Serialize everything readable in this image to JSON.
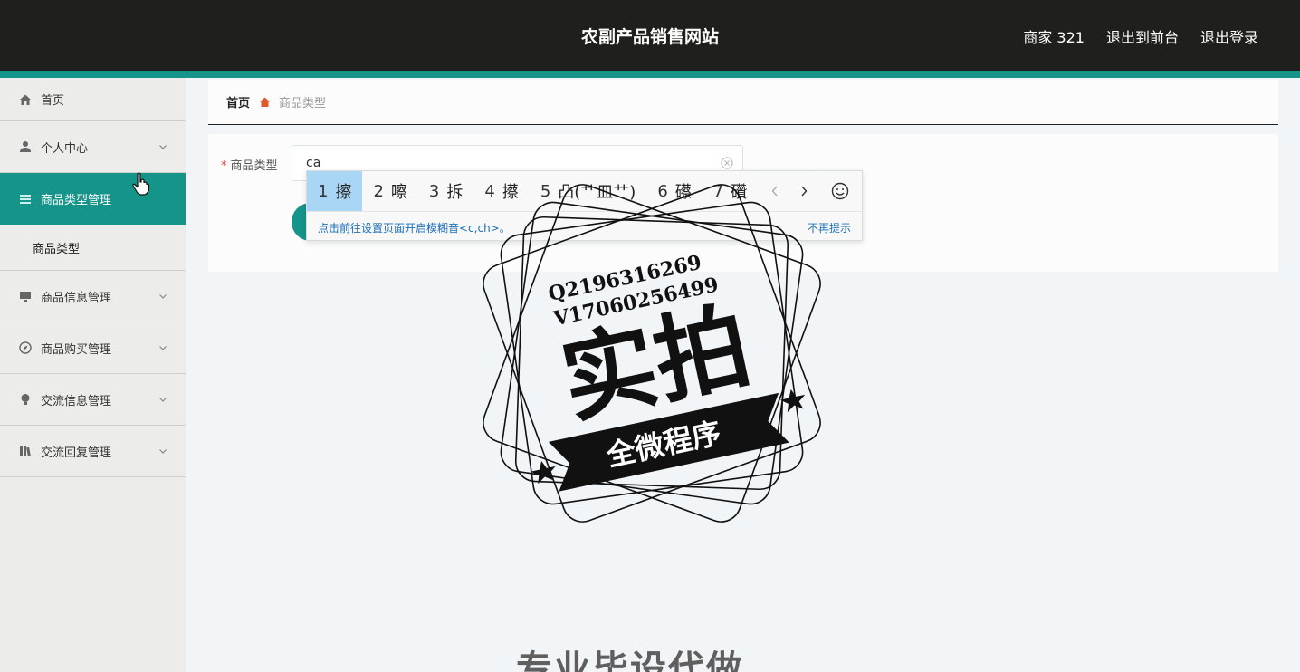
{
  "header": {
    "title": "农副产品销售网站",
    "user": "商家 321",
    "exit_front": "退出到前台",
    "logout": "退出登录"
  },
  "sidebar": {
    "items": [
      {
        "label": "首页",
        "icon": "home-icon"
      },
      {
        "label": "个人中心",
        "icon": "user-icon"
      },
      {
        "label": "商品类型管理",
        "icon": "list-icon"
      },
      {
        "label": "商品信息管理",
        "icon": "monitor-icon"
      },
      {
        "label": "商品购买管理",
        "icon": "compass-icon"
      },
      {
        "label": "交流信息管理",
        "icon": "bulb-icon"
      },
      {
        "label": "交流回复管理",
        "icon": "book-icon"
      }
    ],
    "submenu": [
      "商品类型"
    ]
  },
  "breadcrumb": {
    "home": "首页",
    "current": "商品类型"
  },
  "form": {
    "label": "商品类型",
    "required_mark": "*",
    "value": "ca"
  },
  "ime": {
    "candidates": [
      {
        "num": "1",
        "text": "擦"
      },
      {
        "num": "2",
        "text": "嚓"
      },
      {
        "num": "3",
        "text": "拆"
      },
      {
        "num": "4",
        "text": "攃"
      },
      {
        "num": "5",
        "text": "凸(艹皿艹)"
      },
      {
        "num": "6",
        "text": "礤"
      },
      {
        "num": "7",
        "text": "礸"
      }
    ],
    "hint": "点击前往设置页面开启模糊音<c,ch>。",
    "dismiss": "不再提示"
  },
  "watermark": {
    "line1": "Q2196316269",
    "line2": "V17060256499",
    "main": "实拍",
    "ribbon": "全微程序"
  },
  "bottom_text": "专业毕设代做",
  "colors": {
    "accent": "#15958a",
    "topbar": "#1f201e",
    "ime_selected": "#a9d6f5"
  }
}
